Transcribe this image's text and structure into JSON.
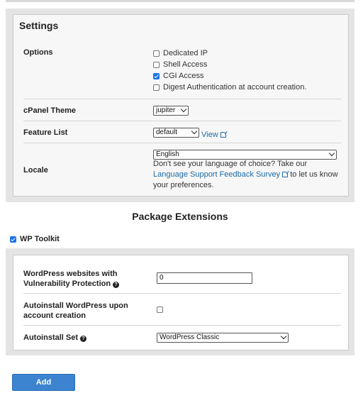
{
  "settings": {
    "title": "Settings",
    "options": {
      "label": "Options",
      "items": [
        {
          "label": "Dedicated IP",
          "checked": false
        },
        {
          "label": "Shell Access",
          "checked": false
        },
        {
          "label": "CGI Access",
          "checked": true
        },
        {
          "label": "Digest Authentication at account creation.",
          "checked": false
        }
      ]
    },
    "theme": {
      "label": "cPanel Theme",
      "value": "jupiter"
    },
    "feature_list": {
      "label": "Feature List",
      "value": "default",
      "link": "View"
    },
    "locale": {
      "label": "Locale",
      "value": "English",
      "help_prefix": "Don't see your language of choice? Take our",
      "help_link": "Language Support Feedback Survey",
      "help_suffix": "to let us know your preferences."
    }
  },
  "package_extensions": {
    "title": "Package Extensions",
    "wp_toolkit": {
      "label": "WP Toolkit",
      "checked": true,
      "vuln_label_line1": "WordPress websites with",
      "vuln_label_line2": "Vulnerability Protection",
      "vuln_value": "0",
      "autoinstall_line1": "Autoinstall WordPress upon",
      "autoinstall_line2": "account creation",
      "autoinstall_checked": false,
      "autoinstall_set_label": "Autoinstall Set",
      "autoinstall_set_value": "WordPress Classic"
    }
  },
  "actions": {
    "add_label": "Add"
  },
  "colors": {
    "accent": "#3d84d0",
    "link": "#1b6aa5",
    "checkbox_checked": "#1a73e8"
  }
}
